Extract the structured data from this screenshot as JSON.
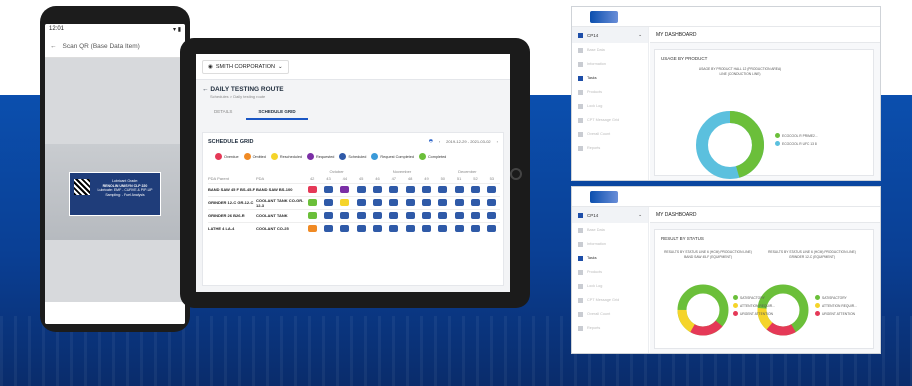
{
  "phone": {
    "time": "12:01",
    "status_icons": "▾ ▮",
    "header_title": "Scan QR (Base Data Item)",
    "card_line1": "Lubricant Grade:",
    "card_line2": "RENOLIN UNISYN CLP 220",
    "card_line3": "Lubricate: EMF - CURVE & PIP-UP",
    "card_line4": "Sampling: - Fuel Analysis"
  },
  "tablet": {
    "org_selector": "SMITH CORPORATION",
    "page_title": "DAILY TESTING ROUTE",
    "breadcrumb": "Schedules > Daily testing route",
    "tabs": [
      {
        "label": "DETAILS",
        "active": false
      },
      {
        "label": "SCHEDULE GRID",
        "active": true
      }
    ],
    "grid_title": "SCHEDULE GRID",
    "date_range": "2019-12-29 - 2021-03-02",
    "legend": [
      {
        "label": "Overdue",
        "color": "#e53957",
        "glyph": "!"
      },
      {
        "label": "Omitted",
        "color": "#f08a24",
        "glyph": "–"
      },
      {
        "label": "Rescheduled",
        "color": "#f5d42a",
        "glyph": "↻"
      },
      {
        "label": "Requested",
        "color": "#7b2fa6",
        "glyph": "+"
      },
      {
        "label": "Scheduled",
        "color": "#2f5aa8",
        "glyph": "○"
      },
      {
        "label": "Request Completed",
        "color": "#3a9ad9",
        "glyph": "✓"
      },
      {
        "label": "Completed",
        "color": "#6bbf3a",
        "glyph": "✓"
      }
    ],
    "month_headers": [
      "October",
      "November",
      "December"
    ],
    "week_headers": [
      "42",
      "43",
      "44",
      "45",
      "46",
      "47",
      "48",
      "49",
      "50",
      "51",
      "52",
      "53"
    ],
    "col_location": "PDA Parent",
    "col_pda": "PDA",
    "rows": [
      {
        "location": "BAND SAW 45 F BS-45-F",
        "pda": "BAND SAW BS-100",
        "first": "#e53957",
        "second": "#2f5aa8",
        "third": "#7b2fa6"
      },
      {
        "location": "GRINDER 12-C GR-12-C",
        "pda": "COOLANT TANK CO-GR-12-3",
        "first": "#6bbf3a",
        "second": "#2f5aa8",
        "third": "#f5d42a"
      },
      {
        "location": "GRINDER 26 B26-R",
        "pda": "COOLANT TANK",
        "first": "#6bbf3a",
        "second": "#2f5aa8",
        "third": "#2f5aa8"
      },
      {
        "location": "LATHE 4 LA-4",
        "pda": "COOLANT CO-25",
        "first": "#f08a24",
        "second": "#2f5aa8",
        "third": "#2f5aa8"
      }
    ]
  },
  "dash1": {
    "sidebar_select": "CP14",
    "sidebar_items": [
      "Base Data",
      "Information",
      "Tasks",
      "Products",
      "Lock Log",
      "CPT Message Grid",
      "Overall Count",
      "Reports"
    ],
    "header": "MY DASHBOARD",
    "card_title": "USAGE BY PRODUCT",
    "chart_sub": "USAGE BY PRODUCT HALL 12 (PRODUCTION AREA) LINE (CONDUCTION LINE)",
    "legend": [
      {
        "label": "ECOCOOL R PRIME2...",
        "color": "#6bbf3a"
      },
      {
        "label": "ECOCOOL R UFC 13 8",
        "color": "#5bc0de"
      }
    ]
  },
  "dash2": {
    "sidebar_select": "CP14",
    "sidebar_items": [
      "Base Data",
      "Information",
      "Tasks",
      "Products",
      "Lock Log",
      "CPT Message Grid",
      "Overall Count",
      "Reports"
    ],
    "header": "MY DASHBOARD",
    "card_title": "RESULT BY STATUS",
    "chart1_sub": "RESULTS BY STATUS LINE 6 (HCM) PRODUCTION LINE) BAND SAW 45-F (EQUIPMENT)",
    "chart2_sub": "RESULTS BY STATUS LINE 6 (HCM) PRODUCTION LINE) GRINDER 12-C (EQUIPMENT)",
    "legend": [
      {
        "label": "SATISFACTORY",
        "color": "#6bbf3a"
      },
      {
        "label": "ATTENTION REQUIR...",
        "color": "#f5d42a"
      },
      {
        "label": "URGENT ATTENTION",
        "color": "#e53957"
      }
    ]
  }
}
